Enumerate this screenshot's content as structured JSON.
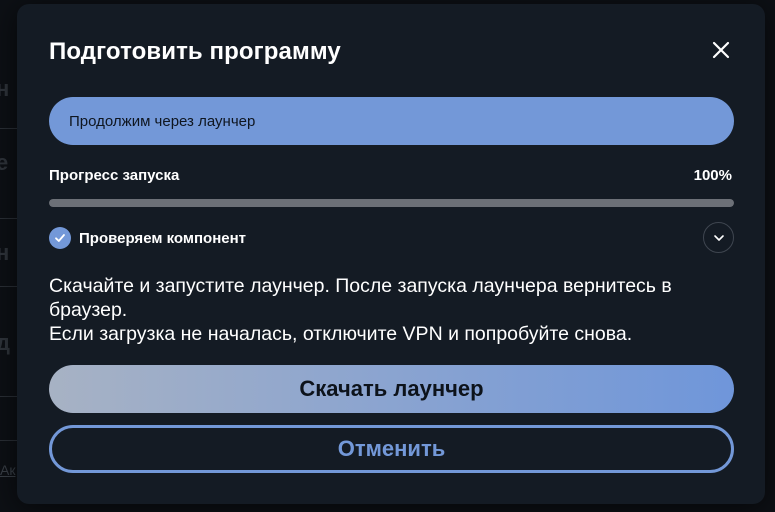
{
  "background": {
    "footer_link": "Ак"
  },
  "dialog": {
    "title": "Подготовить программу",
    "close_icon": "close-icon",
    "status_text": "Продолжим через лаунчер",
    "progress": {
      "label": "Прогресс запуска",
      "value_text": "100%",
      "value": 100
    },
    "check": {
      "icon": "check-circle-icon",
      "label": "Проверяем компонент",
      "expand_icon": "chevron-down-icon"
    },
    "description": {
      "line1": "Скачайте и запустите лаунчер. После запуска лаунчера вернитесь в браузер.",
      "line2": "Если загрузка не началась, отключите VPN и попробуйте снова."
    },
    "primary_button": "Скачать лаунчер",
    "secondary_button": "Отменить"
  },
  "colors": {
    "accent": "#7398d8",
    "dialog_bg": "#141b24",
    "page_bg": "#0d1015"
  }
}
